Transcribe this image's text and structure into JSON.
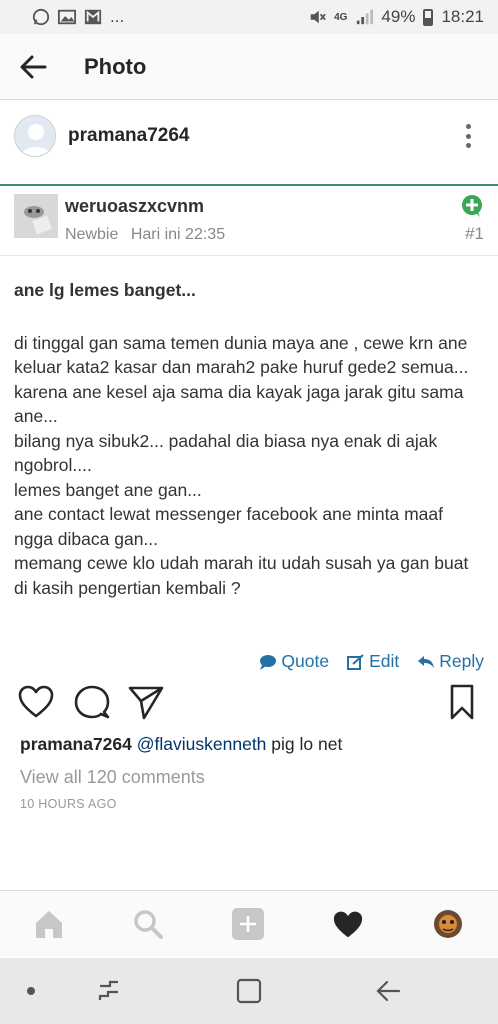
{
  "status_bar": {
    "left_ellipsis": "...",
    "network": "4G",
    "battery": "49%",
    "time": "18:21"
  },
  "app_bar": {
    "title": "Photo"
  },
  "post_header": {
    "username": "pramana7264"
  },
  "photo": {
    "forum_username": "weruoaszxcvnm",
    "rank": "Newbie",
    "timestamp": "Hari ini 22:35",
    "post_number": "#1",
    "title": "ane lg lemes banget...",
    "body": "di tinggal gan sama temen dunia maya ane , cewe krn ane keluar kata2 kasar dan marah2 pake huruf gede2 semua...\nkarena ane kesel aja sama dia kayak jaga jarak gitu sama ane...\nbilang nya sibuk2... padahal dia biasa nya enak di ajak ngobrol....\nlemes banget ane gan...\nane contact lewat messenger facebook ane minta maaf ngga dibaca gan...\nmemang cewe klo udah marah itu udah susah ya gan buat di kasih pengertian kembali ?",
    "actions": {
      "quote": "Quote",
      "edit": "Edit",
      "reply": "Reply"
    }
  },
  "caption": {
    "username": "pramana7264",
    "mention": "@flaviuskenneth",
    "text": "pig lo net"
  },
  "comments": {
    "view_all": "View all 120 comments"
  },
  "time_ago": "10 HOURS AGO",
  "colors": {
    "accent_teal": "#3c8a7a",
    "forum_link": "#2472a4",
    "mention": "#003569",
    "muted": "#999999"
  }
}
